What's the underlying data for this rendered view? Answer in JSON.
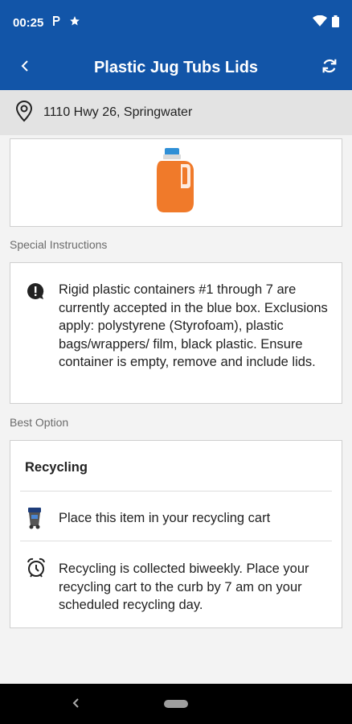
{
  "status_bar": {
    "time": "00:25",
    "icons": [
      "p-icon",
      "star-icon",
      "wifi-icon",
      "battery-icon"
    ]
  },
  "app_bar": {
    "title": "Plastic Jug Tubs Lids",
    "back_icon": "chevron-left-icon",
    "refresh_icon": "refresh-icon"
  },
  "location": {
    "address": "1110 Hwy 26, Springwater",
    "icon": "location-pin-icon"
  },
  "item_image": {
    "icon": "detergent-jug-icon",
    "color": "#f07a2a",
    "cap_color": "#2f8fd6"
  },
  "special_instructions": {
    "label": "Special Instructions",
    "text": "Rigid plastic containers #1 through 7 are currently accepted in the blue box. Exclusions apply: polystyrene (Styrofoam), plastic bags/wrappers/ film, black plastic. Ensure container is empty, remove and include lids.",
    "icon": "alert-bubble-icon"
  },
  "best_option": {
    "label": "Best Option",
    "title": "Recycling",
    "rows": [
      {
        "icon": "recycling-cart-icon",
        "text": "Place this item in your recycling cart"
      },
      {
        "icon": "alarm-clock-icon",
        "text": "Recycling is collected biweekly. Place your recycling cart to the curb by 7 am on your scheduled recycling day."
      }
    ]
  },
  "nav": {
    "back_icon": "nav-back-icon",
    "home_icon": "nav-home-pill-icon"
  },
  "colors": {
    "app_bar": "#1255a8",
    "location_bar": "#e3e3e3",
    "background": "#f3f3f3"
  }
}
